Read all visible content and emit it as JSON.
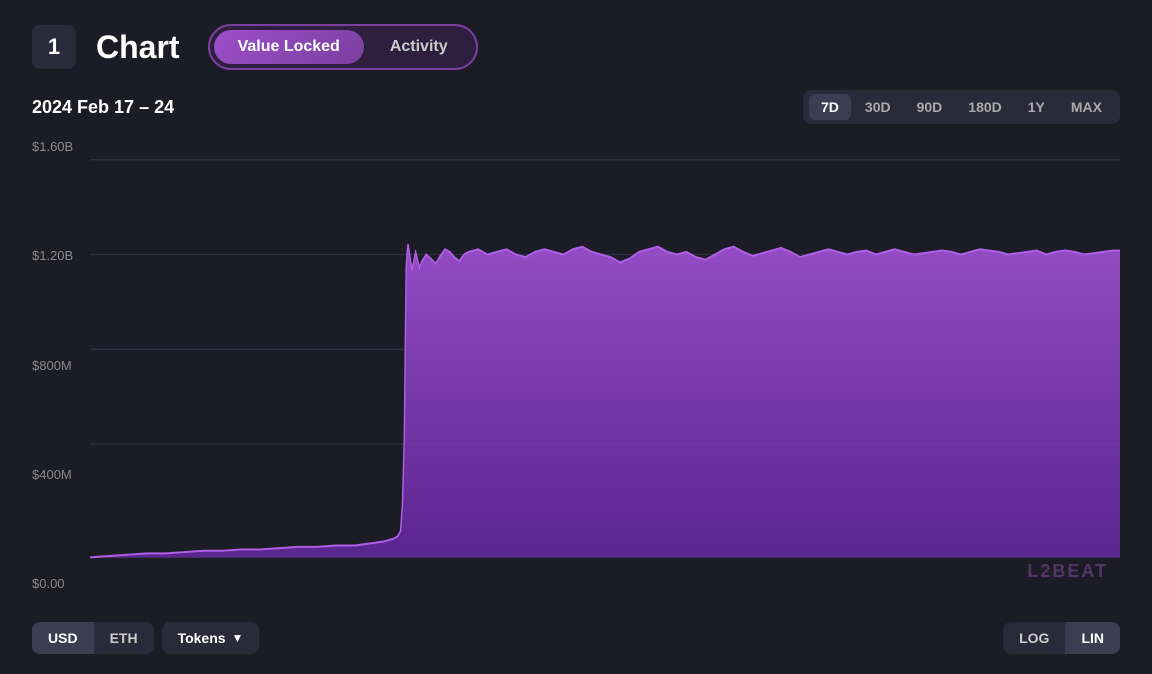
{
  "header": {
    "badge": "1",
    "title": "Chart",
    "tabs": [
      {
        "id": "value-locked",
        "label": "Value Locked",
        "active": true
      },
      {
        "id": "activity",
        "label": "Activity",
        "active": false
      }
    ]
  },
  "controls": {
    "date_range": "2024 Feb 17 – 24",
    "time_ranges": [
      {
        "id": "7d",
        "label": "7D",
        "active": true
      },
      {
        "id": "30d",
        "label": "30D",
        "active": false
      },
      {
        "id": "90d",
        "label": "90D",
        "active": false
      },
      {
        "id": "180d",
        "label": "180D",
        "active": false
      },
      {
        "id": "1y",
        "label": "1Y",
        "active": false
      },
      {
        "id": "max",
        "label": "MAX",
        "active": false
      }
    ]
  },
  "chart": {
    "y_labels": [
      "$1.60B",
      "$1.20B",
      "$800M",
      "$400M",
      "$0.00"
    ],
    "watermark": "L2BEAT",
    "colors": {
      "fill": "#7b3fcc",
      "fill_opacity": "0.85",
      "grid_line": "#2e2e42",
      "spike_fill": "#2a1a3a"
    }
  },
  "bottom_controls": {
    "units": [
      {
        "id": "usd",
        "label": "USD",
        "active": true
      },
      {
        "id": "eth",
        "label": "ETH",
        "active": false
      }
    ],
    "tokens_label": "Tokens",
    "tokens_chevron": "▼",
    "scales": [
      {
        "id": "log",
        "label": "LOG",
        "active": false
      },
      {
        "id": "lin",
        "label": "LIN",
        "active": true
      }
    ]
  }
}
